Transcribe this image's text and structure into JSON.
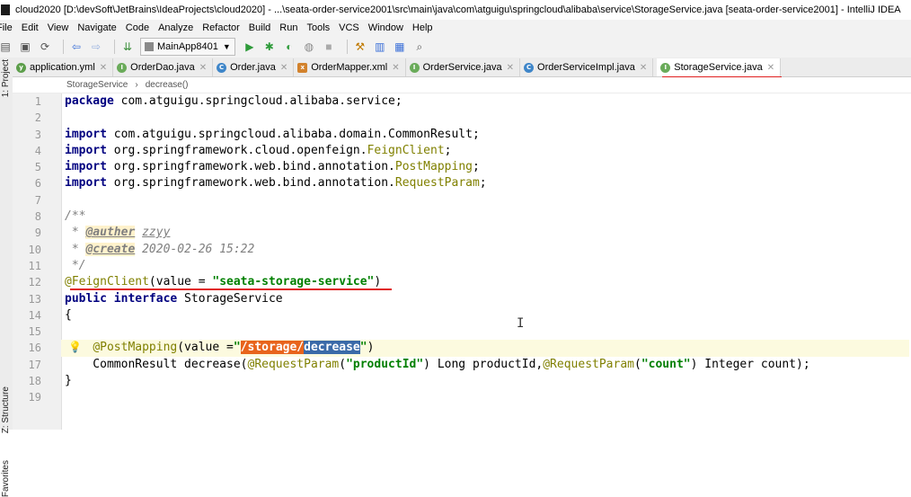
{
  "window": {
    "title": "cloud2020 [D:\\devSoft\\JetBrains\\IdeaProjects\\cloud2020] - ...\\seata-order-service2001\\src\\main\\java\\com\\atguigu\\springcloud\\alibaba\\service\\StorageService.java [seata-order-service2001] - IntelliJ IDEA"
  },
  "menu": [
    "File",
    "Edit",
    "View",
    "Navigate",
    "Code",
    "Analyze",
    "Refactor",
    "Build",
    "Run",
    "Tools",
    "VCS",
    "Window",
    "Help"
  ],
  "toolbar": {
    "run_config": "MainApp8401"
  },
  "tabs": [
    {
      "label": "application.yml",
      "icon": "yaml-icon"
    },
    {
      "label": "OrderDao.java",
      "icon": "interface-icon"
    },
    {
      "label": "Order.java",
      "icon": "class-icon"
    },
    {
      "label": "OrderMapper.xml",
      "icon": "xml-icon"
    },
    {
      "label": "OrderService.java",
      "icon": "interface-icon"
    },
    {
      "label": "OrderServiceImpl.java",
      "icon": "class-icon"
    },
    {
      "label": "StorageService.java",
      "icon": "interface-icon",
      "active": true
    }
  ],
  "breadcrumb": {
    "file": "StorageService",
    "sep": "›",
    "method": "decrease()"
  },
  "side_tools": [
    "1: Project",
    "Z: Structure",
    "Favorites"
  ],
  "line_numbers": [
    "1",
    "2",
    "3",
    "4",
    "5",
    "6",
    "7",
    "8",
    "9",
    "10",
    "11",
    "12",
    "13",
    "14",
    "15",
    "16",
    "17",
    "18",
    "19"
  ],
  "code": {
    "l1_kw": "package",
    "l1_rest": " com.atguigu.springcloud.alibaba.service;",
    "imp": "import",
    "l3_rest": " com.atguigu.springcloud.alibaba.domain.CommonResult;",
    "l4_pkg": " org.springframework.cloud.openfeign.",
    "l4_cls": "FeignClient",
    "l4_end": ";",
    "l5_pkg": " org.springframework.web.bind.annotation.",
    "l5_cls": "PostMapping",
    "l5_end": ";",
    "l6_pkg": " org.springframework.web.bind.annotation.",
    "l6_cls": "RequestParam",
    "l6_end": ";",
    "l8": "/**",
    "l9_pre": " * ",
    "l9_tag": "@auther",
    "l9_val": "zzyy",
    "l10_pre": " * ",
    "l10_tag": "@create",
    "l10_val": "2020-02-26 15:22",
    "l11": " */",
    "l12_an": "@FeignClient",
    "l12_mid": "(value = ",
    "l12_str": "\"seata-storage-service\"",
    "l12_end": ")",
    "l13_kw": "public interface",
    "l13_rest": " StorageService",
    "l14": "{",
    "l16_indent": "    ",
    "l16_an": "@PostMapping",
    "l16_mid": "(value =",
    "l16_q": "\"",
    "l16_path": "/storage/",
    "l16_sel": "decrease",
    "l16_q2": "\"",
    "l16_end": ")",
    "l17_a": "    CommonResult decrease(",
    "l17_an1": "@RequestParam",
    "l17_b": "(",
    "l17_s1": "\"productId\"",
    "l17_c": ") Long productId,",
    "l17_an2": "@RequestParam",
    "l17_d": "(",
    "l17_s2": "\"count\"",
    "l17_e": ") Integer count);",
    "l18": "}"
  },
  "colors": {
    "accent_red": "#e02020",
    "keyword": "#000080",
    "string": "#008000",
    "annotation": "#808000"
  }
}
